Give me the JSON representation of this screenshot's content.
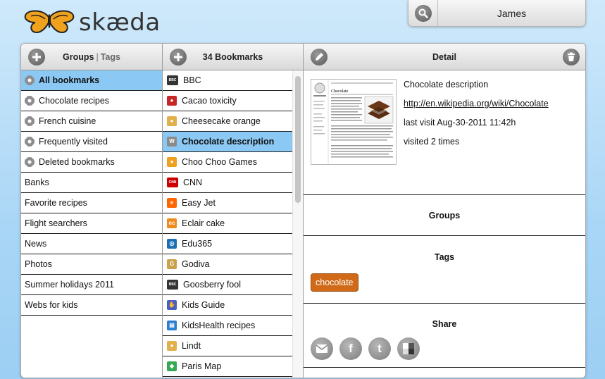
{
  "app": {
    "logo_text": "skæda"
  },
  "user": {
    "name": "James"
  },
  "groups_panel": {
    "title_groups": "Groups",
    "separator": "|",
    "title_tags": "Tags",
    "items": [
      {
        "label": "All bookmarks",
        "icon": "gear-icon",
        "selected": true
      },
      {
        "label": "Chocolate recipes",
        "icon": "gear-icon"
      },
      {
        "label": "French cuisine",
        "icon": "gear-icon"
      },
      {
        "label": "Frequently visited",
        "icon": "gear-icon"
      },
      {
        "label": "Deleted bookmarks",
        "icon": "gear-icon"
      },
      {
        "label": "Banks"
      },
      {
        "label": "Favorite recipes"
      },
      {
        "label": "Flight searchers"
      },
      {
        "label": "News"
      },
      {
        "label": "Photos"
      },
      {
        "label": "Summer holidays 2011"
      },
      {
        "label": "Webs for kids"
      }
    ]
  },
  "bookmarks_panel": {
    "title": "34 Bookmarks",
    "items": [
      {
        "label": "BBC",
        "icon": "bbc-favicon",
        "glyph": "BBC",
        "color": "#333333"
      },
      {
        "label": "Cacao toxicity",
        "icon": "cherry-favicon",
        "glyph": "●",
        "color": "#c62828"
      },
      {
        "label": "Cheesecake orange",
        "icon": "coin-favicon",
        "glyph": "●",
        "color": "#e0b04a"
      },
      {
        "label": "Chocolate description",
        "icon": "wikipedia-favicon",
        "glyph": "W",
        "color": "#8a8a8a",
        "selected": true
      },
      {
        "label": "Choo Choo Games",
        "icon": "games-favicon",
        "glyph": "●",
        "color": "#f0a020"
      },
      {
        "label": "CNN",
        "icon": "cnn-favicon",
        "glyph": "CNN",
        "color": "#cc0000"
      },
      {
        "label": "Easy Jet",
        "icon": "easyjet-favicon",
        "glyph": "e",
        "color": "#ff6600"
      },
      {
        "label": "Eclair cake",
        "icon": "eclair-favicon",
        "glyph": "ec",
        "color": "#f08a1e"
      },
      {
        "label": "Edu365",
        "icon": "edu365-favicon",
        "glyph": "◎",
        "color": "#1a6fb5"
      },
      {
        "label": "Godiva",
        "icon": "godiva-favicon",
        "glyph": "G",
        "color": "#c9a24a"
      },
      {
        "label": "Goosberry fool",
        "icon": "bbc-favicon",
        "glyph": "BBC",
        "color": "#333333"
      },
      {
        "label": "Kids Guide",
        "icon": "kids-favicon",
        "glyph": "✋",
        "color": "#4a5ec4"
      },
      {
        "label": "KidsHealth recipes",
        "icon": "document-favicon",
        "glyph": "▤",
        "color": "#2a7fd4"
      },
      {
        "label": "Lindt",
        "icon": "lindt-favicon",
        "glyph": "●",
        "color": "#e0b04a"
      },
      {
        "label": "Paris Map",
        "icon": "maps-favicon",
        "glyph": "◆",
        "color": "#34a853"
      }
    ]
  },
  "detail_panel": {
    "title": "Detail",
    "thumbnail_title": "Chocolate",
    "name": "Chocolate description",
    "url": "http://en.wikipedia.org/wiki/Chocolate",
    "last_visit": "last visit Aug-30-2011 11:42h",
    "visits": "visited 2 times",
    "groups_title": "Groups",
    "tags_title": "Tags",
    "tags": [
      "chocolate"
    ],
    "share_title": "Share",
    "share": [
      "email-icon",
      "facebook-icon",
      "twitter-icon",
      "delicious-icon"
    ]
  },
  "colors": {
    "selection": "#8cc8f4",
    "tag": "#d06a18",
    "background": "#a9d6f6"
  }
}
